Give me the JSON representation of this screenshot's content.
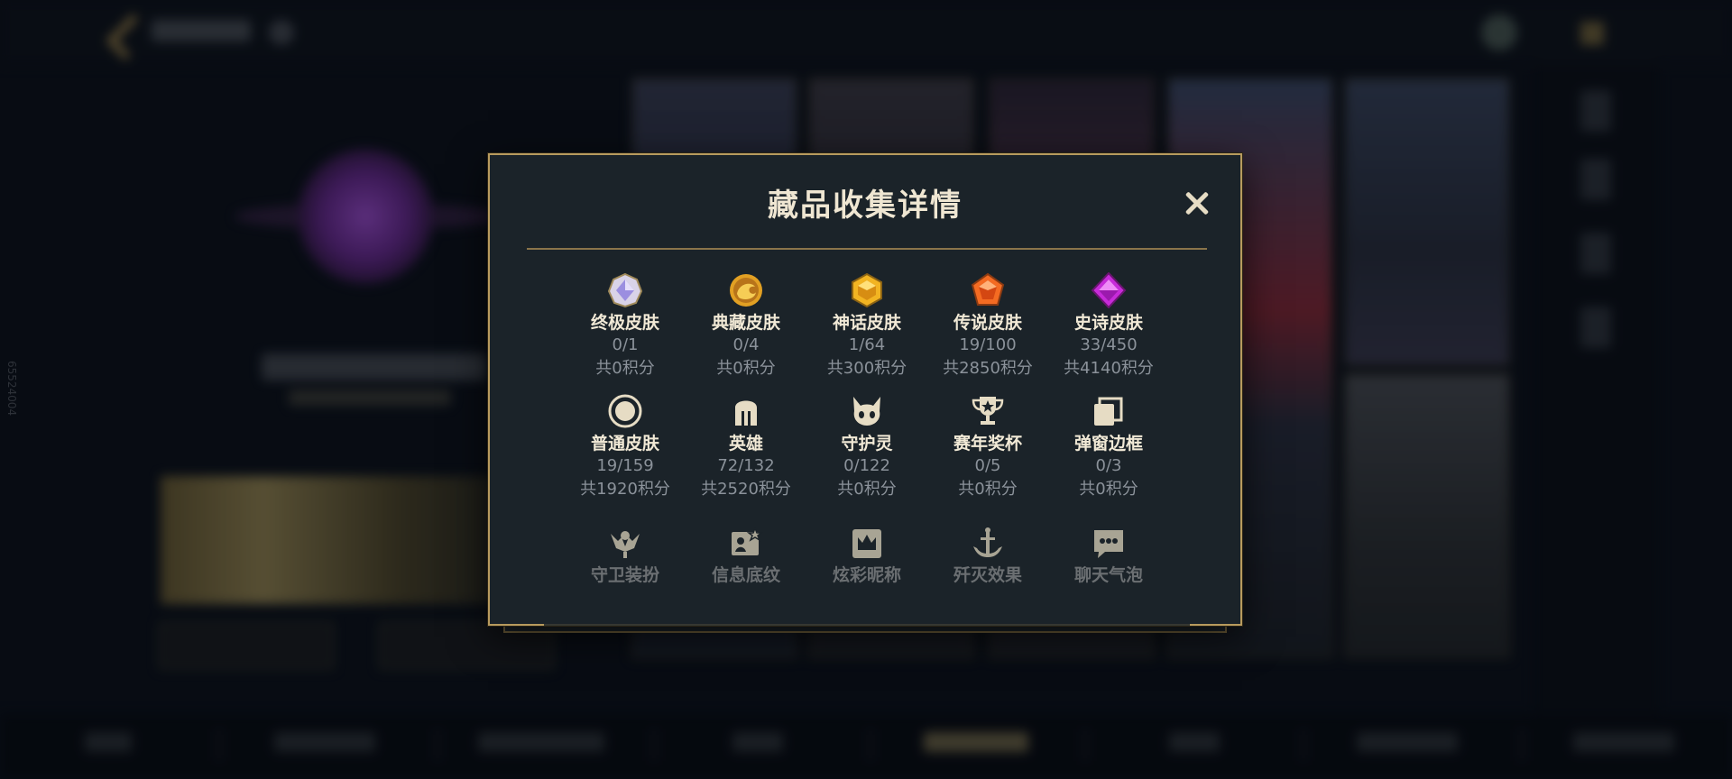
{
  "side_text": "65524004",
  "modal": {
    "title": "藏品收集详情",
    "close_icon": "close-icon",
    "categories": [
      {
        "name": "终极皮肤",
        "count": "0/1",
        "points": "共0积分",
        "icon": "ultimate-gem-icon"
      },
      {
        "name": "典藏皮肤",
        "count": "0/4",
        "points": "共0积分",
        "icon": "dragon-gem-icon"
      },
      {
        "name": "神话皮肤",
        "count": "1/64",
        "points": "共300积分",
        "icon": "mythic-gem-icon"
      },
      {
        "name": "传说皮肤",
        "count": "19/100",
        "points": "共2850积分",
        "icon": "legendary-gem-icon"
      },
      {
        "name": "史诗皮肤",
        "count": "33/450",
        "points": "共4140积分",
        "icon": "epic-gem-icon"
      },
      {
        "name": "普通皮肤",
        "count": "19/159",
        "points": "共1920积分",
        "icon": "standard-skin-icon"
      },
      {
        "name": "英雄",
        "count": "72/132",
        "points": "共2520积分",
        "icon": "helmet-icon"
      },
      {
        "name": "守护灵",
        "count": "0/122",
        "points": "共0积分",
        "icon": "little-legend-icon"
      },
      {
        "name": "赛年奖杯",
        "count": "0/5",
        "points": "共0积分",
        "icon": "trophy-icon"
      },
      {
        "name": "弹窗边框",
        "count": "0/3",
        "points": "共0积分",
        "icon": "border-icon"
      },
      {
        "name": "守卫装扮",
        "count": "",
        "points": "",
        "icon": "ward-icon"
      },
      {
        "name": "信息底纹",
        "count": "",
        "points": "",
        "icon": "banner-icon"
      },
      {
        "name": "炫彩昵称",
        "count": "",
        "points": "",
        "icon": "crown-icon"
      },
      {
        "name": "歼灭效果",
        "count": "",
        "points": "",
        "icon": "finisher-icon"
      },
      {
        "name": "聊天气泡",
        "count": "",
        "points": "",
        "icon": "chat-bubble-icon"
      }
    ]
  }
}
